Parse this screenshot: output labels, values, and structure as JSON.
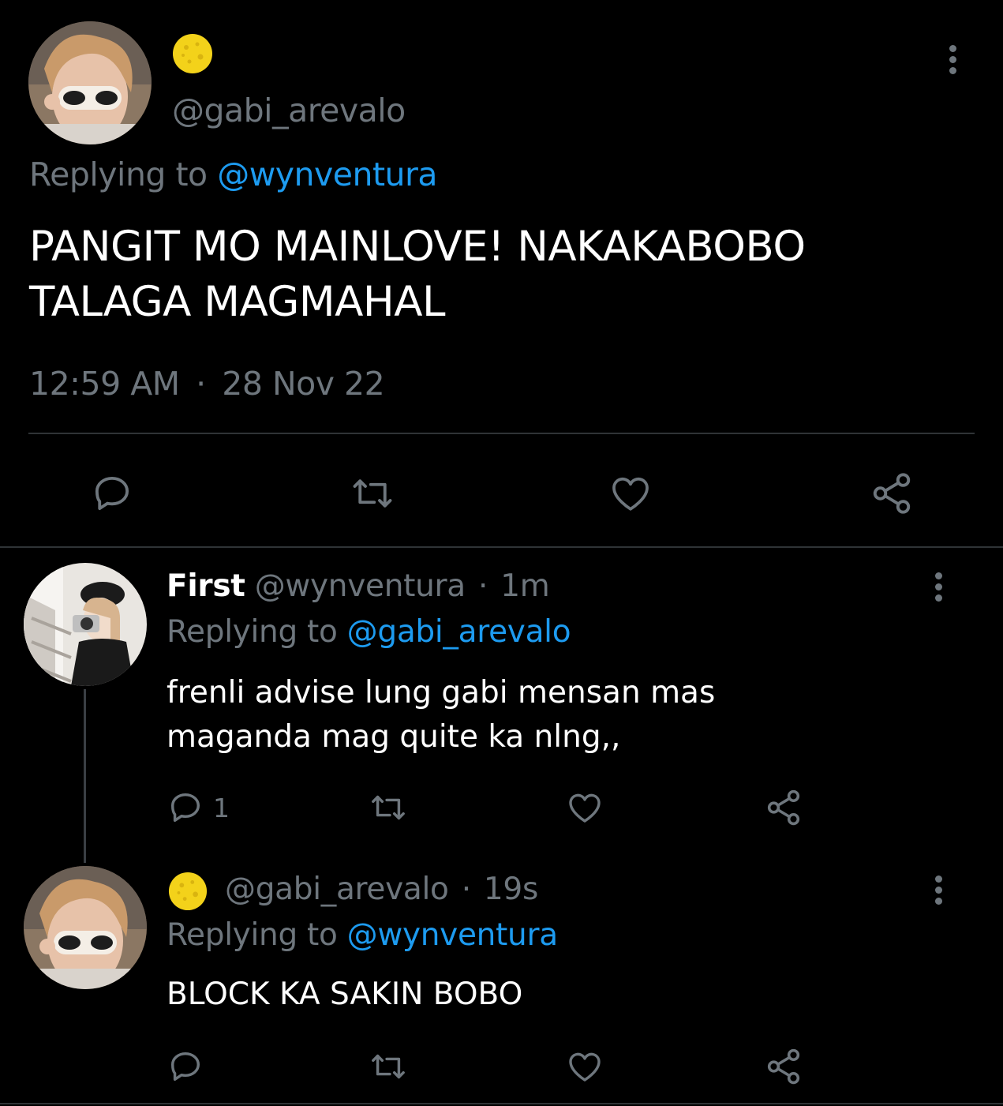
{
  "main_tweet": {
    "handle": "@gabi_arevalo",
    "name_emoji": "crescent-yellow-circle",
    "replying_prefix": "Replying to ",
    "replying_handle": "@wynventura",
    "text_line1": "PANGIT MO MAINLOVE! NAKAKABOBO",
    "text_line2": "TALAGA MAGMAHAL",
    "time": "12:59 AM",
    "separator": "·",
    "date": "28 Nov 22"
  },
  "reply1": {
    "name": "First",
    "handle": "@wynventura",
    "separator": "·",
    "age": "1m",
    "replying_prefix": "Replying to ",
    "replying_handle": "@gabi_arevalo",
    "text_line1": "frenli advise lung gabi mensan mas",
    "text_line2": "maganda mag quite ka nlng,,",
    "reply_count": "1"
  },
  "reply2": {
    "handle": "@gabi_arevalo",
    "separator": "·",
    "age": "19s",
    "replying_prefix": "Replying to ",
    "replying_handle": "@wynventura",
    "text": "BLOCK KA SAKIN BOBO"
  },
  "colors": {
    "background": "#000000",
    "muted": "#6e767d",
    "link": "#1d9bf0",
    "text": "#ffffff",
    "divider": "#2f3336",
    "emoji": "#f3d21a"
  }
}
